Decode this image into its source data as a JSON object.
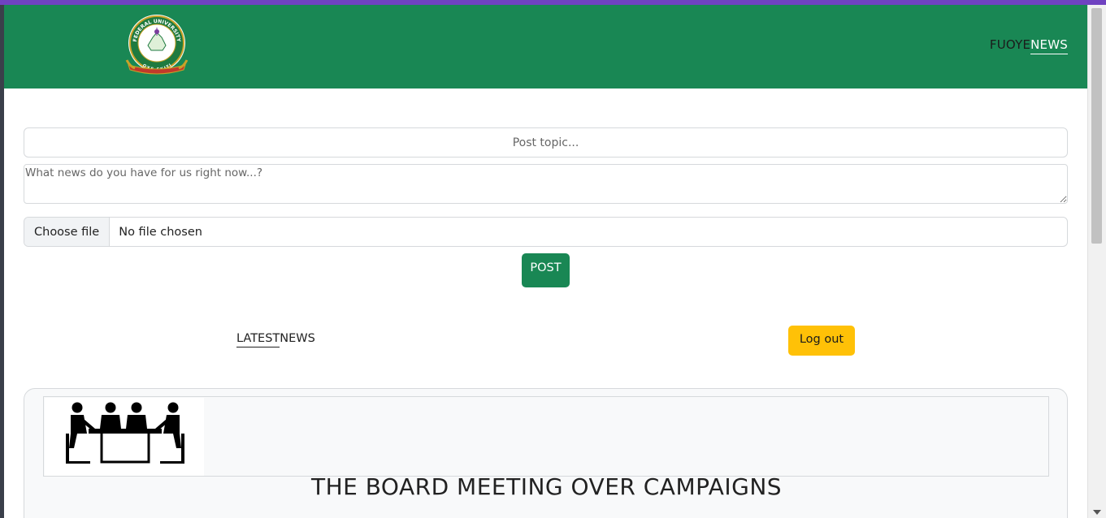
{
  "header": {
    "brand_part1": "FUOYE",
    "brand_part2": "NEWS",
    "logo_name": "federal-university-oye-ekiti-logo",
    "logo_text_top": "FEDERAL UNIVERSITY",
    "logo_text_bottom": "OYE-EKITI",
    "background_color": "#198754"
  },
  "post_form": {
    "topic_placeholder": "Post topic...",
    "topic_value": "",
    "news_placeholder": "What news do you have for us right now...?",
    "news_value": "",
    "file_button_label": "Choose file",
    "file_status": "No file chosen",
    "post_button_label": "POST"
  },
  "feed": {
    "latest_part1": "LATEST",
    "latest_part2": "NEWS",
    "logout_label": "Log out",
    "logout_color": "#ffc107"
  },
  "cards": [
    {
      "image_name": "board-meeting-icon",
      "title": "THE BOARD MEETING OVER CAMPAIGNS"
    }
  ],
  "colors": {
    "accent_top": "#6f42c1",
    "primary_green": "#198754",
    "warning_yellow": "#ffc107"
  }
}
